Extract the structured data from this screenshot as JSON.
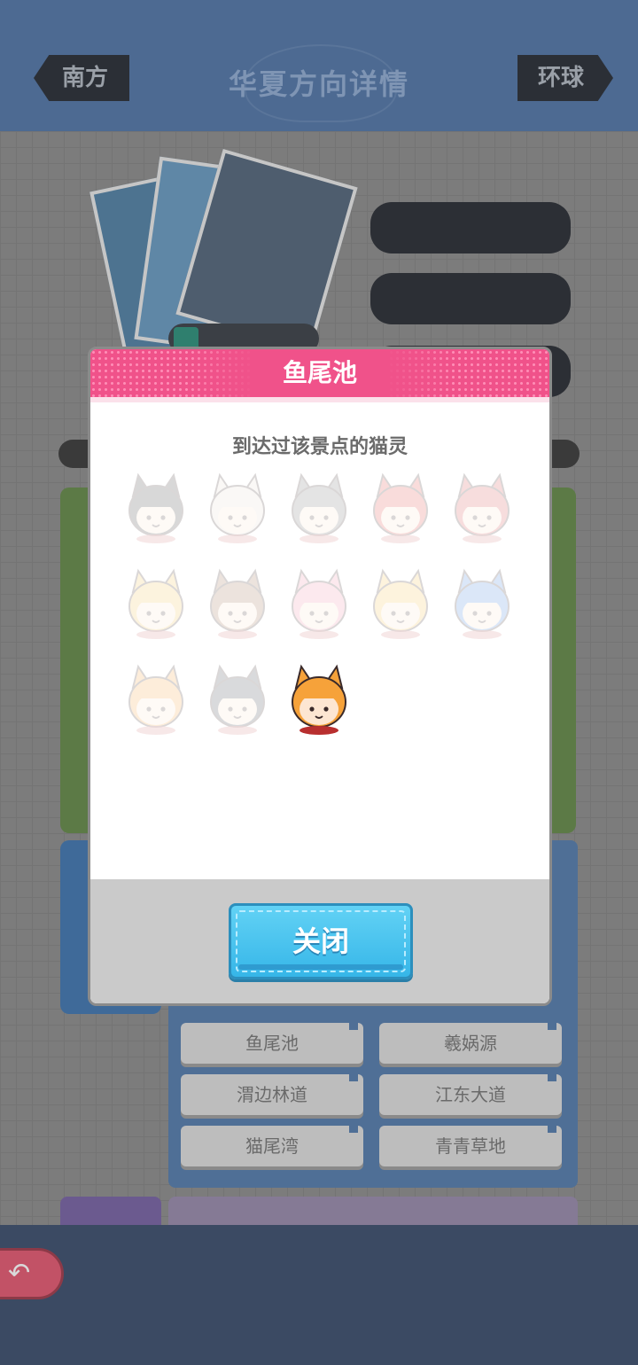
{
  "header": {
    "prev_label": "南方",
    "title": "华夏方向详情",
    "next_label": "环球"
  },
  "spots": [
    "鱼尾池",
    "羲娲源",
    "渭边林道",
    "江东大道",
    "猫尾湾",
    "青青草地"
  ],
  "modal": {
    "title": "鱼尾池",
    "subtitle": "到达过该景点的猫灵",
    "close_label": "关闭",
    "avatars": [
      {
        "icon": "black-fox-girl-avatar-icon",
        "visited": false
      },
      {
        "icon": "white-hair-boy-avatar-icon",
        "visited": false
      },
      {
        "icon": "hooded-girl-avatar-icon",
        "visited": false
      },
      {
        "icon": "red-cat-girl-avatar-icon",
        "visited": false
      },
      {
        "icon": "red-hood-avatar-icon",
        "visited": false
      },
      {
        "icon": "witch-hat-avatar-icon",
        "visited": false
      },
      {
        "icon": "brown-cat-girl-avatar-icon",
        "visited": false
      },
      {
        "icon": "pink-cat-girl-avatar-icon",
        "visited": false
      },
      {
        "icon": "cap-girl-avatar-icon",
        "visited": false
      },
      {
        "icon": "blue-fox-girl-avatar-icon",
        "visited": false
      },
      {
        "icon": "orange-fox-girl-avatar-icon",
        "visited": false
      },
      {
        "icon": "dark-helmet-avatar-icon",
        "visited": false
      },
      {
        "icon": "orange-cat-girl-avatar-icon",
        "visited": true
      }
    ]
  },
  "colors": {
    "modal_header": "#f0528a",
    "close_button": "#36b6e8",
    "visited_hair": "#f6a23a"
  }
}
